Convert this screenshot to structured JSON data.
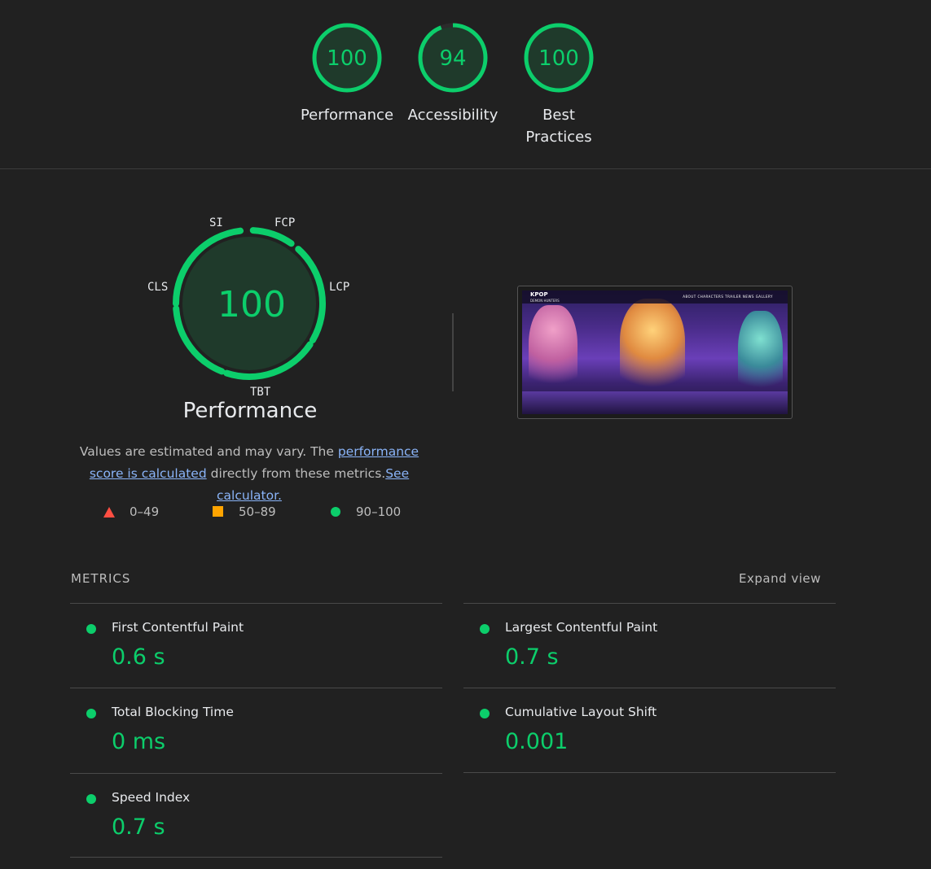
{
  "colors": {
    "pass": "#0cce6b",
    "average": "#ffa400",
    "fail": "#ff4e42",
    "background": "#212121"
  },
  "top_gauges": [
    {
      "score": "100",
      "label": "Performance",
      "fraction": 1.0
    },
    {
      "score": "94",
      "label": "Accessibility",
      "fraction": 0.94
    },
    {
      "score": "100",
      "label": "Best Practices",
      "fraction": 1.0
    }
  ],
  "performance": {
    "score": "100",
    "title": "Performance",
    "gauge_labels": {
      "si": "SI",
      "fcp": "FCP",
      "lcp": "LCP",
      "tbt": "TBT",
      "cls": "CLS"
    },
    "description": {
      "text1": "Values are estimated and may vary. The ",
      "link1": "performance score is calculated",
      "text2": " directly from these metrics.",
      "link2": "See calculator."
    },
    "legend": [
      {
        "icon": "triangle-icon",
        "range": "0–49"
      },
      {
        "icon": "square-icon",
        "range": "50–89"
      },
      {
        "icon": "circle-icon",
        "range": "90–100"
      }
    ],
    "screenshot": {
      "logo": "KPOP",
      "logo_sub": "DEMON HUNTERS",
      "nav_links": "ABOUT  CHARACTERS  TRAILER  NEWS  GALLERY"
    }
  },
  "metrics": {
    "header": "METRICS",
    "expand_label": "Expand view",
    "items": [
      {
        "name": "First Contentful Paint",
        "value": "0.6 s"
      },
      {
        "name": "Largest Contentful Paint",
        "value": "0.7 s"
      },
      {
        "name": "Total Blocking Time",
        "value": "0 ms"
      },
      {
        "name": "Cumulative Layout Shift",
        "value": "0.001"
      },
      {
        "name": "Speed Index",
        "value": "0.7 s"
      }
    ]
  }
}
